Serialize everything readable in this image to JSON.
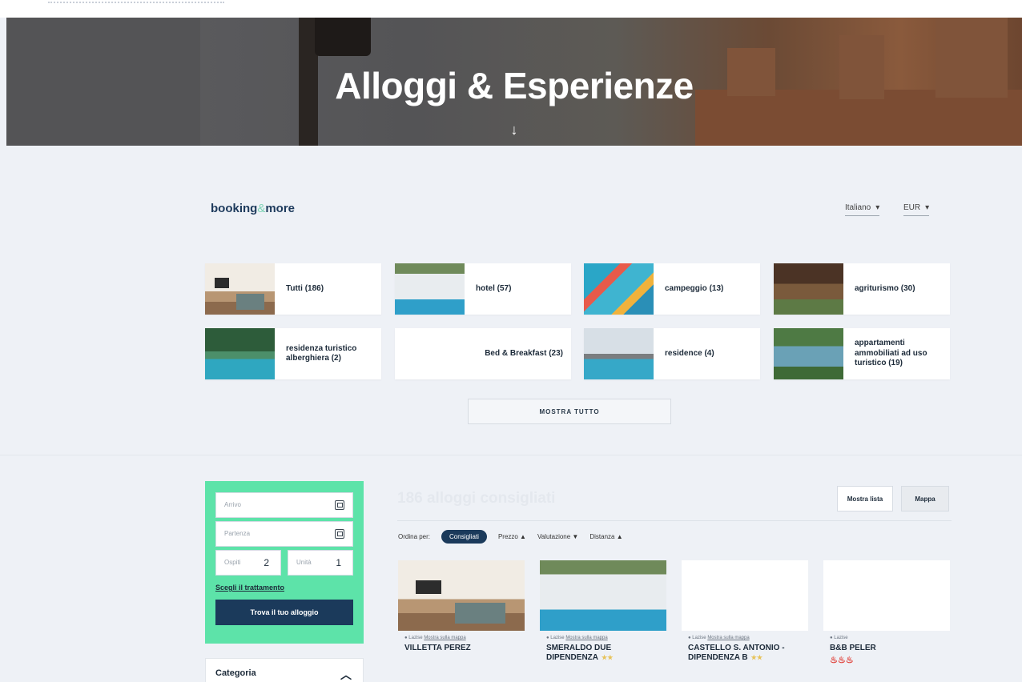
{
  "hero": {
    "title": "Alloggi & Esperienze",
    "arrow": "↓"
  },
  "header": {
    "logo_main": "booking",
    "logo_amp": "&",
    "logo_end": "more",
    "language": "Italiano",
    "currency": "EUR"
  },
  "categories": [
    {
      "label": "Tutti (186)",
      "thumb": "room"
    },
    {
      "label": "hotel (57)",
      "thumb": "hotel"
    },
    {
      "label": "campeggio (13)",
      "thumb": "water"
    },
    {
      "label": "agriturismo (30)",
      "thumb": "farm"
    },
    {
      "label": "residenza turistico alberghiera (2)",
      "thumb": "resid"
    },
    {
      "label": "Bed & Breakfast (23)",
      "thumb": ""
    },
    {
      "label": "residence (4)",
      "thumb": "resid2"
    },
    {
      "label": "appartamenti ammobiliati ad uso turistico (19)",
      "thumb": "lake"
    }
  ],
  "show_all_label": "MOSTRA TUTTO",
  "search": {
    "arrival_placeholder": "Arrivo",
    "departure_placeholder": "Partenza",
    "guests_label": "Ospiti",
    "guests_value": "2",
    "units_label": "Unità",
    "units_value": "1",
    "treatment_link": "Scegli il trattamento",
    "submit": "Trova il tuo alloggio"
  },
  "filters": {
    "category_title": "Categoria"
  },
  "results": {
    "title": "186 alloggi consigliati",
    "list_button": "Mostra lista",
    "map_button": "Mappa",
    "sort_label": "Ordina per:",
    "sort_options": [
      "Consigliati",
      "Prezzo ▲",
      "Valutazione ▼",
      "Distanza ▲"
    ],
    "cards": [
      {
        "loc": "Lazise",
        "loc_link": "Mostra sulla mappa",
        "name": "VILLETTA PEREZ",
        "stars": "",
        "badges": "",
        "thumb": "room"
      },
      {
        "loc": "Lazise",
        "loc_link": "Mostra sulla mappa",
        "name": "SMERALDO DUE DIPENDENZA",
        "stars": "★★",
        "badges": "",
        "thumb": "hotel"
      },
      {
        "loc": "Lazise",
        "loc_link": "Mostra sulla mappa",
        "name": "CASTELLO S. ANTONIO - DIPENDENZA B",
        "stars": "★★",
        "badges": "",
        "thumb": ""
      },
      {
        "loc": "Lazise",
        "loc_link": "",
        "name": "B&B PELER",
        "stars": "",
        "badges": "♨♨♨",
        "thumb": ""
      }
    ]
  }
}
